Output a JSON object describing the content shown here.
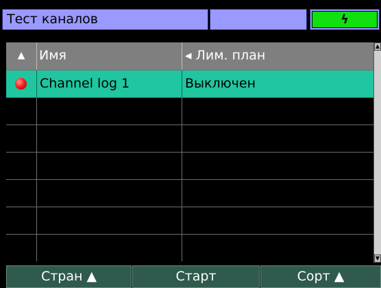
{
  "title": "Тест каналов",
  "battery_icon": "lightning-icon",
  "battery_color": "#10e010",
  "table": {
    "sort_arrow": "▲",
    "headers": [
      "Имя",
      "◂ Лим. план"
    ],
    "rows": [
      {
        "status": "red-dot-icon",
        "name": "Channel log 1",
        "plan": "Выключен",
        "selected": true
      },
      {
        "status": "",
        "name": "",
        "plan": "",
        "selected": false
      },
      {
        "status": "",
        "name": "",
        "plan": "",
        "selected": false
      },
      {
        "status": "",
        "name": "",
        "plan": "",
        "selected": false
      },
      {
        "status": "",
        "name": "",
        "plan": "",
        "selected": false
      },
      {
        "status": "",
        "name": "",
        "plan": "",
        "selected": false
      },
      {
        "status": "",
        "name": "",
        "plan": "",
        "selected": false
      }
    ]
  },
  "buttons": {
    "pages": "Стран ▲",
    "start": "Старт",
    "sort": "Сорт ▲"
  },
  "colors": {
    "title_bg": "#9999ff",
    "header_bg": "#7f7f7f",
    "selected_row": "#1fc6a0",
    "button_bg": "#2f5a4d"
  }
}
